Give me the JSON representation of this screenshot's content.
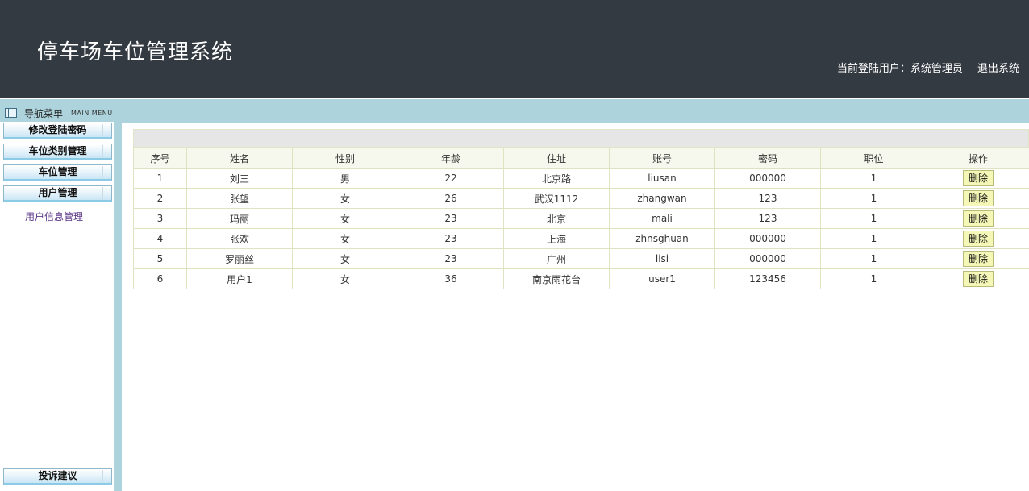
{
  "header": {
    "title": "停车场车位管理系统",
    "current_user_label": "当前登陆用户：系统管理员",
    "logout_label": "退出系统"
  },
  "menu": {
    "title": "导航菜单",
    "subtitle": "MAIN MENU",
    "items": [
      {
        "label": "修改登陆密码"
      },
      {
        "label": "车位类别管理"
      },
      {
        "label": "车位管理"
      },
      {
        "label": "用户管理"
      }
    ],
    "sub_items": [
      {
        "label": "用户信息管理"
      }
    ],
    "bottom_item": {
      "label": "投诉建议"
    }
  },
  "table": {
    "columns": [
      "序号",
      "姓名",
      "性别",
      "年龄",
      "住址",
      "账号",
      "密码",
      "职位",
      "操作"
    ],
    "delete_label": "删除",
    "rows": [
      {
        "no": "1",
        "name": "刘三",
        "gender": "男",
        "age": "22",
        "address": "北京路",
        "account": "liusan",
        "password": "000000",
        "position": "1"
      },
      {
        "no": "2",
        "name": "张望",
        "gender": "女",
        "age": "26",
        "address": "武汉1112",
        "account": "zhangwan",
        "password": "123",
        "position": "1"
      },
      {
        "no": "3",
        "name": "玛丽",
        "gender": "女",
        "age": "23",
        "address": "北京",
        "account": "mali",
        "password": "123",
        "position": "1"
      },
      {
        "no": "4",
        "name": "张欢",
        "gender": "女",
        "age": "23",
        "address": "上海",
        "account": "zhnsghuan",
        "password": "000000",
        "position": "1"
      },
      {
        "no": "5",
        "name": "罗丽丝",
        "gender": "女",
        "age": "23",
        "address": "广州",
        "account": "lisi",
        "password": "000000",
        "position": "1"
      },
      {
        "no": "6",
        "name": "用户1",
        "gender": "女",
        "age": "36",
        "address": "南京雨花台",
        "account": "user1",
        "password": "123456",
        "position": "1"
      }
    ]
  }
}
